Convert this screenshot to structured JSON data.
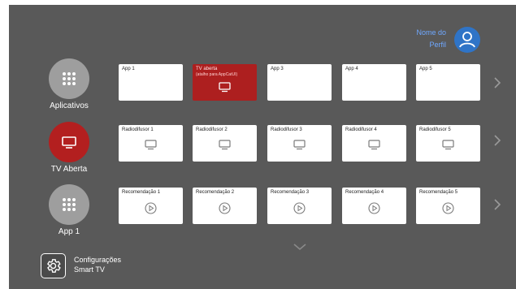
{
  "profile": {
    "name_line1": "Nome do",
    "name_line2": "Perfil"
  },
  "categories": [
    {
      "label": "Aplicativos",
      "icon": "grid-icon"
    },
    {
      "label": "TV Aberta",
      "icon": "tv-icon"
    },
    {
      "label": "App 1",
      "icon": "grid-icon"
    }
  ],
  "rows": {
    "apps": [
      {
        "title": "App 1"
      },
      {
        "title": "TV aberta",
        "subtitle": "(atalho para AppCatUI)",
        "selected": true
      },
      {
        "title": "App 3"
      },
      {
        "title": "App 4"
      },
      {
        "title": "App 5"
      }
    ],
    "broadcasters": [
      {
        "title": "Radiodifusor 1"
      },
      {
        "title": "Radiodifusor 2"
      },
      {
        "title": "Radiodifusor 3"
      },
      {
        "title": "Radiodifusor 4"
      },
      {
        "title": "Radiodifusor 5"
      }
    ],
    "recommendations": [
      {
        "title": "Recomendação 1"
      },
      {
        "title": "Recomendação 2"
      },
      {
        "title": "Recomendação 3"
      },
      {
        "title": "Recomendação 4"
      },
      {
        "title": "Recomendação 5"
      }
    ]
  },
  "settings": {
    "line1": "Configurações",
    "line2": "Smart TV"
  },
  "colors": {
    "background": "#595959",
    "accent_red": "#b31f1f",
    "profile_blue": "#2f74c7",
    "profile_text": "#6fa8ff"
  }
}
